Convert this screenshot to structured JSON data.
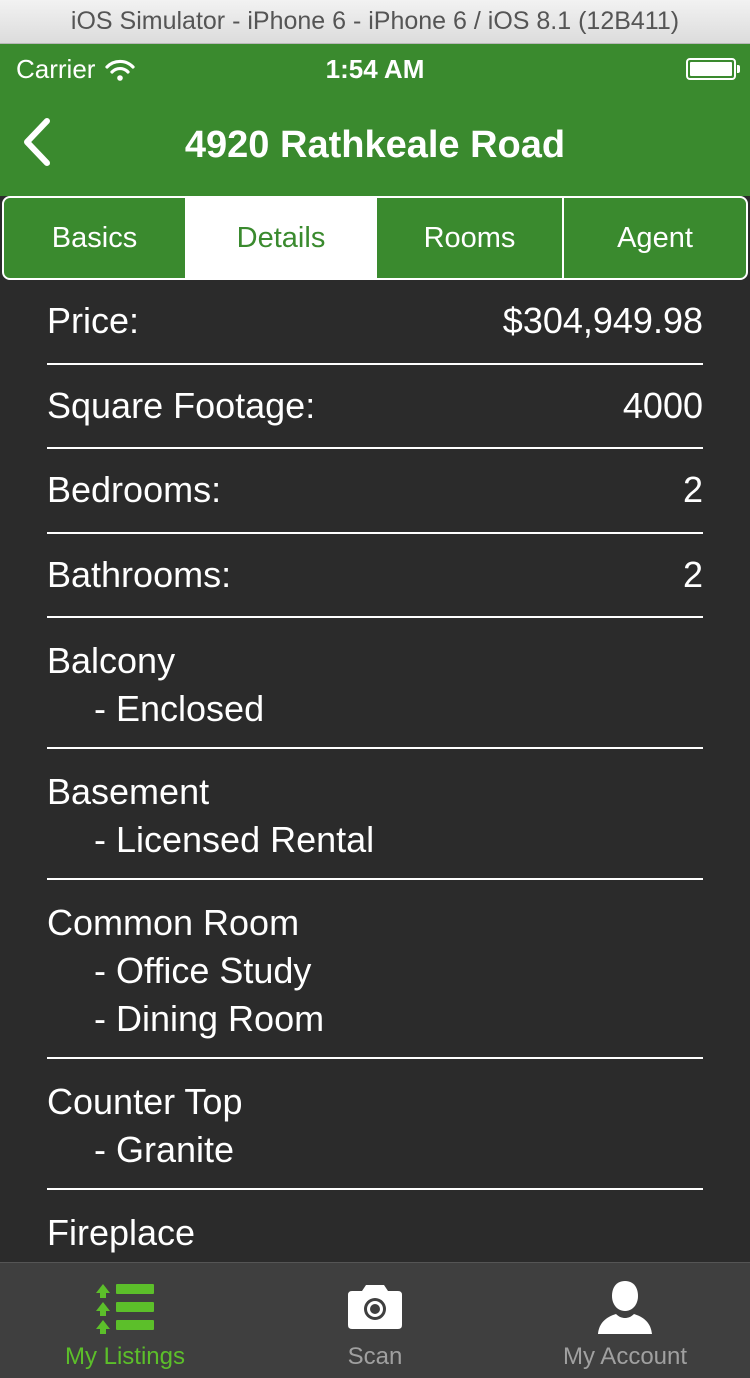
{
  "simulator": {
    "title": "iOS Simulator - iPhone 6 - iPhone 6 / iOS 8.1 (12B411)"
  },
  "status": {
    "carrier": "Carrier",
    "time": "1:54 AM"
  },
  "nav": {
    "title": "4920 Rathkeale Road"
  },
  "tabs": [
    {
      "label": "Basics"
    },
    {
      "label": "Details"
    },
    {
      "label": "Rooms"
    },
    {
      "label": "Agent"
    }
  ],
  "active_tab": "Details",
  "details": {
    "price": {
      "label": "Price:",
      "value": "$304,949.98"
    },
    "sqft": {
      "label": "Square Footage:",
      "value": "4000"
    },
    "bedrooms": {
      "label": "Bedrooms:",
      "value": "2"
    },
    "bathrooms": {
      "label": "Bathrooms:",
      "value": "2"
    }
  },
  "features": [
    {
      "name": "Balcony",
      "items": [
        "- Enclosed"
      ]
    },
    {
      "name": "Basement",
      "items": [
        "- Licensed Rental"
      ]
    },
    {
      "name": "Common Room",
      "items": [
        "- Office Study",
        "- Dining Room"
      ]
    },
    {
      "name": "Counter Top",
      "items": [
        "- Granite"
      ]
    },
    {
      "name": "Fireplace",
      "items": []
    }
  ],
  "tabbar": [
    {
      "label": "My Listings",
      "icon": "list-icon"
    },
    {
      "label": "Scan",
      "icon": "camera-icon"
    },
    {
      "label": "My Account",
      "icon": "person-icon"
    }
  ],
  "colors": {
    "brand_green": "#3a8a2e",
    "active_tab_text": "#5cbf2a",
    "background": "#2b2b2b"
  }
}
